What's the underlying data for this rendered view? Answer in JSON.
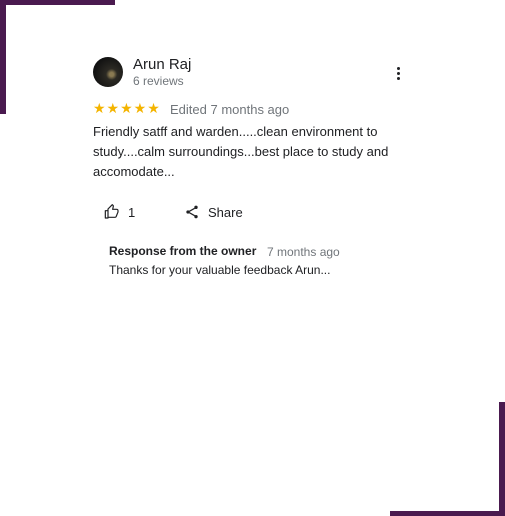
{
  "review": {
    "author": "Arun Raj",
    "reviews_count": "6 reviews",
    "rating": 5,
    "stars_display": "★★★★★",
    "edited": "Edited 7 months ago",
    "text": "Friendly satff and warden.....clean environment to study....calm surroundings...best place to study and accomodate...",
    "like_count": "1",
    "share_label": "Share"
  },
  "owner_response": {
    "title": "Response from the owner",
    "time": "7 months ago",
    "text": "Thanks for your valuable feedback Arun..."
  },
  "colors": {
    "frame": "#4a1a4f",
    "star": "#f4b400",
    "muted_text": "#70757a"
  }
}
